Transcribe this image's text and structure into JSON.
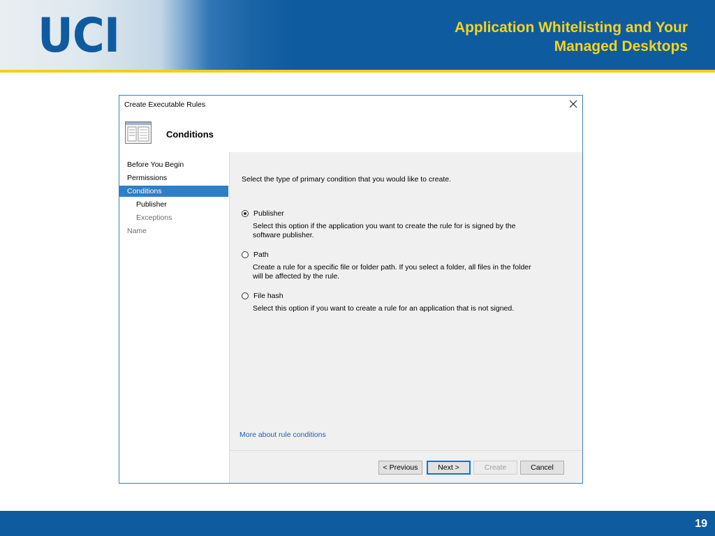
{
  "slide": {
    "logo": "UCI",
    "title_line1": "Application Whitelisting and Your",
    "title_line2": "Managed Desktops",
    "page_number": "19"
  },
  "dialog": {
    "title": "Create Executable Rules",
    "heading": "Conditions",
    "nav": [
      {
        "label": "Before You Begin",
        "state": "normal"
      },
      {
        "label": "Permissions",
        "state": "normal"
      },
      {
        "label": "Conditions",
        "state": "active"
      },
      {
        "label": "Publisher",
        "state": "sub"
      },
      {
        "label": "Exceptions",
        "state": "sub-disabled"
      },
      {
        "label": "Name",
        "state": "disabled"
      }
    ],
    "prompt": "Select the type of primary condition that you would like to create.",
    "options": [
      {
        "label": "Publisher",
        "checked": true,
        "description": "Select this option if the application you want to create the rule for is signed by the software publisher."
      },
      {
        "label": "Path",
        "checked": false,
        "description": "Create a rule for a specific file or folder path. If you select a folder, all files in the folder will be affected by the rule."
      },
      {
        "label": "File hash",
        "checked": false,
        "description": "Select this option if you want to create a rule for an application that is not signed."
      }
    ],
    "more_link": "More about rule conditions",
    "buttons": {
      "previous": "< Previous",
      "next": "Next >",
      "create": "Create",
      "cancel": "Cancel"
    }
  },
  "colors": {
    "brand_blue": "#0f5ba0",
    "title_yellow": "#f3d51e",
    "nav_selected": "#2d7fc7",
    "link": "#1f5fb1"
  }
}
